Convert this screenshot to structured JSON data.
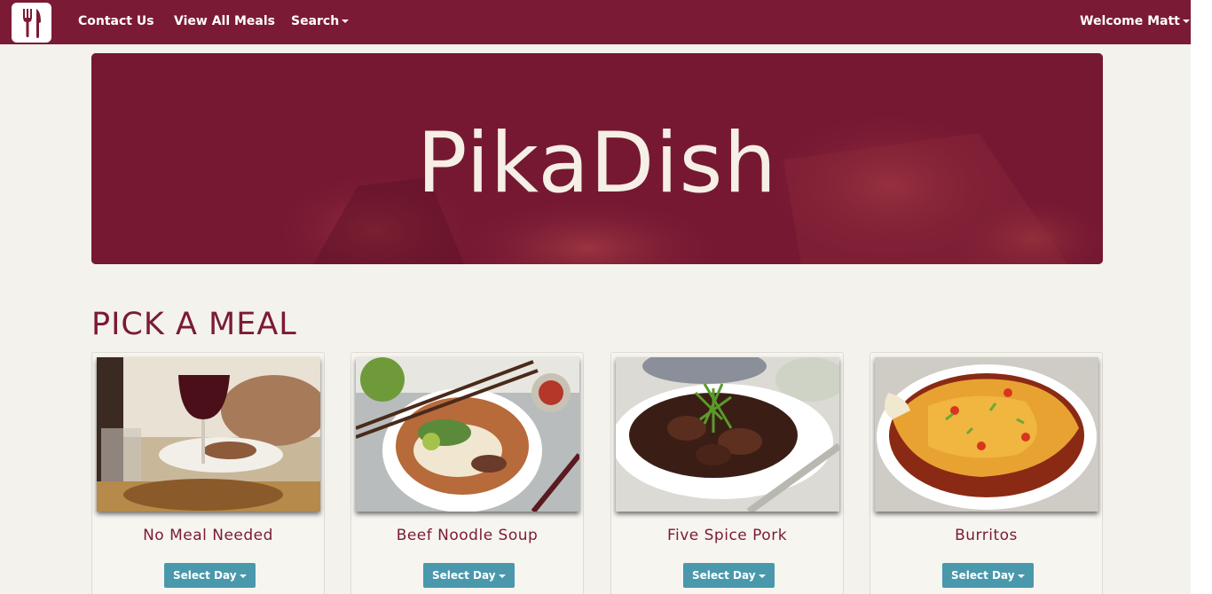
{
  "navbar": {
    "logo_icon": "fork-knife-icon",
    "links": [
      {
        "label": "Contact Us"
      },
      {
        "label": "View All Meals"
      },
      {
        "label": "Search"
      }
    ],
    "user": "Welcome Matt"
  },
  "hero": {
    "title": "PikaDish"
  },
  "section": {
    "title": "PICK A MEAL"
  },
  "meals": [
    {
      "name": "No Meal Needed",
      "button": "Select Day"
    },
    {
      "name": "Beef Noodle Soup",
      "button": "Select Day"
    },
    {
      "name": "Five Spice Pork",
      "button": "Select Day"
    },
    {
      "name": "Burritos",
      "button": "Select Day"
    }
  ],
  "colors": {
    "brand": "#7b1a34",
    "button": "#4a98ac",
    "background": "#f3f2ec"
  }
}
